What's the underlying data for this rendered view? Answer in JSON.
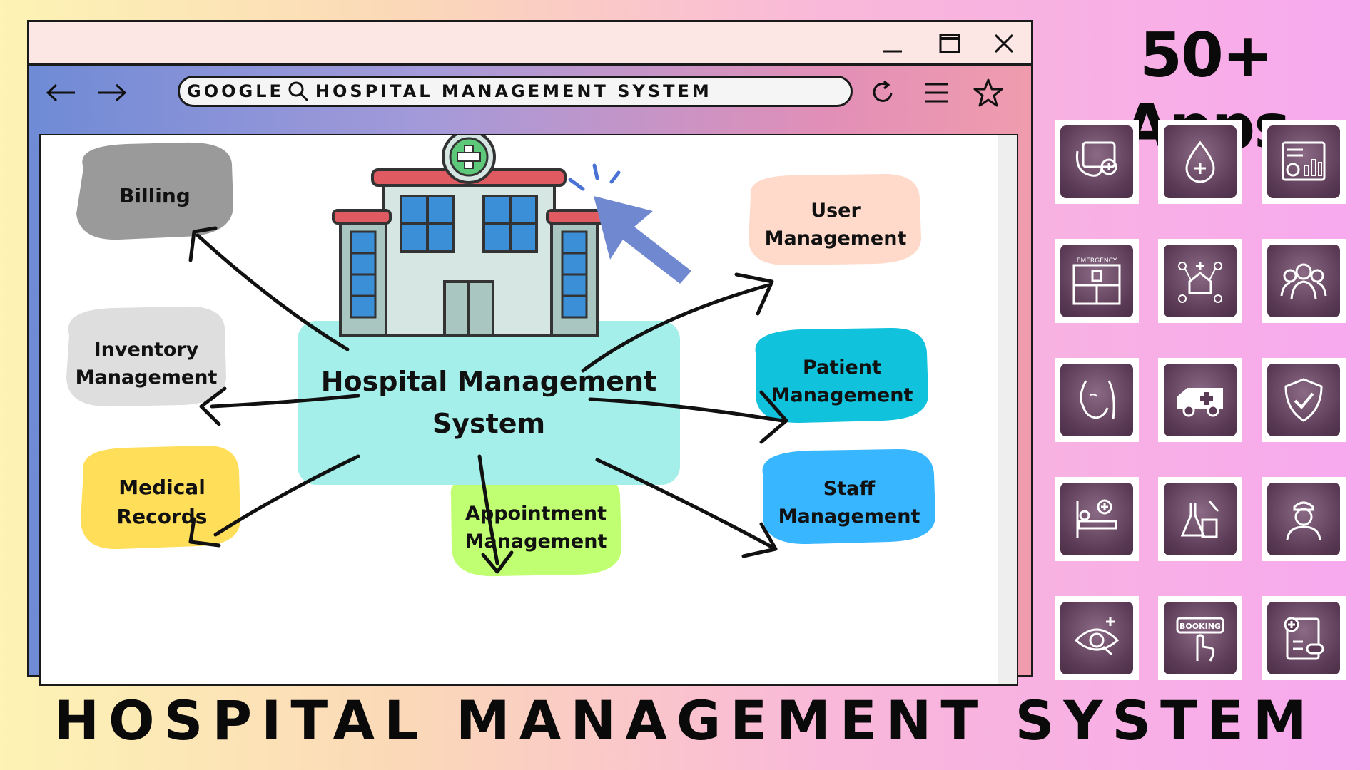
{
  "browser": {
    "url_engine": "GOOGLE",
    "url_text": "HOSPITAL MANAGEMENT SYSTEM"
  },
  "diagram": {
    "central": "Hospital Management System",
    "nodes": {
      "billing": "Billing",
      "inventory": "Inventory Management",
      "medical_records": "Medical Records",
      "appointment": "Appointment Management",
      "user_management": "User Management",
      "patient_management": "Patient Management",
      "staff_management": "Staff Management"
    },
    "colors": {
      "billing": "#9a9a9a",
      "inventory": "#dedede",
      "medical_records": "#ffde59",
      "appointment": "#c1ff72",
      "user_management": "#ffdacb",
      "patient_management": "#11c2dd",
      "staff_management": "#38b6ff",
      "central": "#a4efe9"
    }
  },
  "apps": {
    "title": "50+ Apps",
    "icons": [
      "health-calendar-icon",
      "blood-drop-icon",
      "dashboard-chart-icon",
      "emergency-cabinet-icon",
      "hospital-network-icon",
      "group-users-icon",
      "face-profile-icon",
      "ambulance-icon",
      "shield-check-icon",
      "hospital-bed-icon",
      "lab-flask-icon",
      "nurse-icon",
      "eye-search-icon",
      "booking-touch-icon",
      "prescription-icon"
    ],
    "emergency_label": "EMERGENCY",
    "booking_label": "BOOKING"
  },
  "footer": {
    "title": "HOSPITAL MANAGEMENT SYSTEM"
  }
}
